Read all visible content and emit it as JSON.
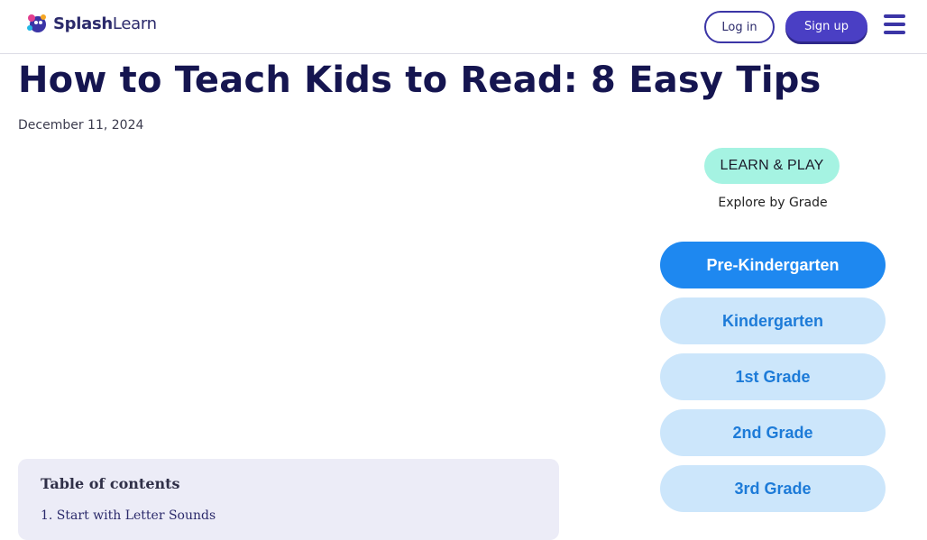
{
  "header": {
    "logo_text_bold": "Splash",
    "logo_text_light": "Learn",
    "login_label": "Log in",
    "signup_label": "Sign up",
    "menu_icon": "hamburger-menu-icon"
  },
  "article": {
    "title": "How to Teach Kids to Read: 8 Easy Tips",
    "date": "December 11, 2024"
  },
  "toc": {
    "title": "Table of contents",
    "items": [
      "1. Start with Letter Sounds"
    ]
  },
  "sidebar": {
    "badge": "LEARN & PLAY",
    "subtitle": "Explore by Grade",
    "grades": [
      {
        "label": "Pre-Kindergarten",
        "active": true
      },
      {
        "label": "Kindergarten",
        "active": false
      },
      {
        "label": "1st Grade",
        "active": false
      },
      {
        "label": "2nd Grade",
        "active": false
      },
      {
        "label": "3rd Grade",
        "active": false
      }
    ]
  },
  "colors": {
    "brand_purple": "#4a3fc4",
    "title_navy": "#151550",
    "grade_active": "#1e88f0",
    "grade_inactive": "#cce6fb",
    "badge_mint": "#a5f3e2"
  }
}
